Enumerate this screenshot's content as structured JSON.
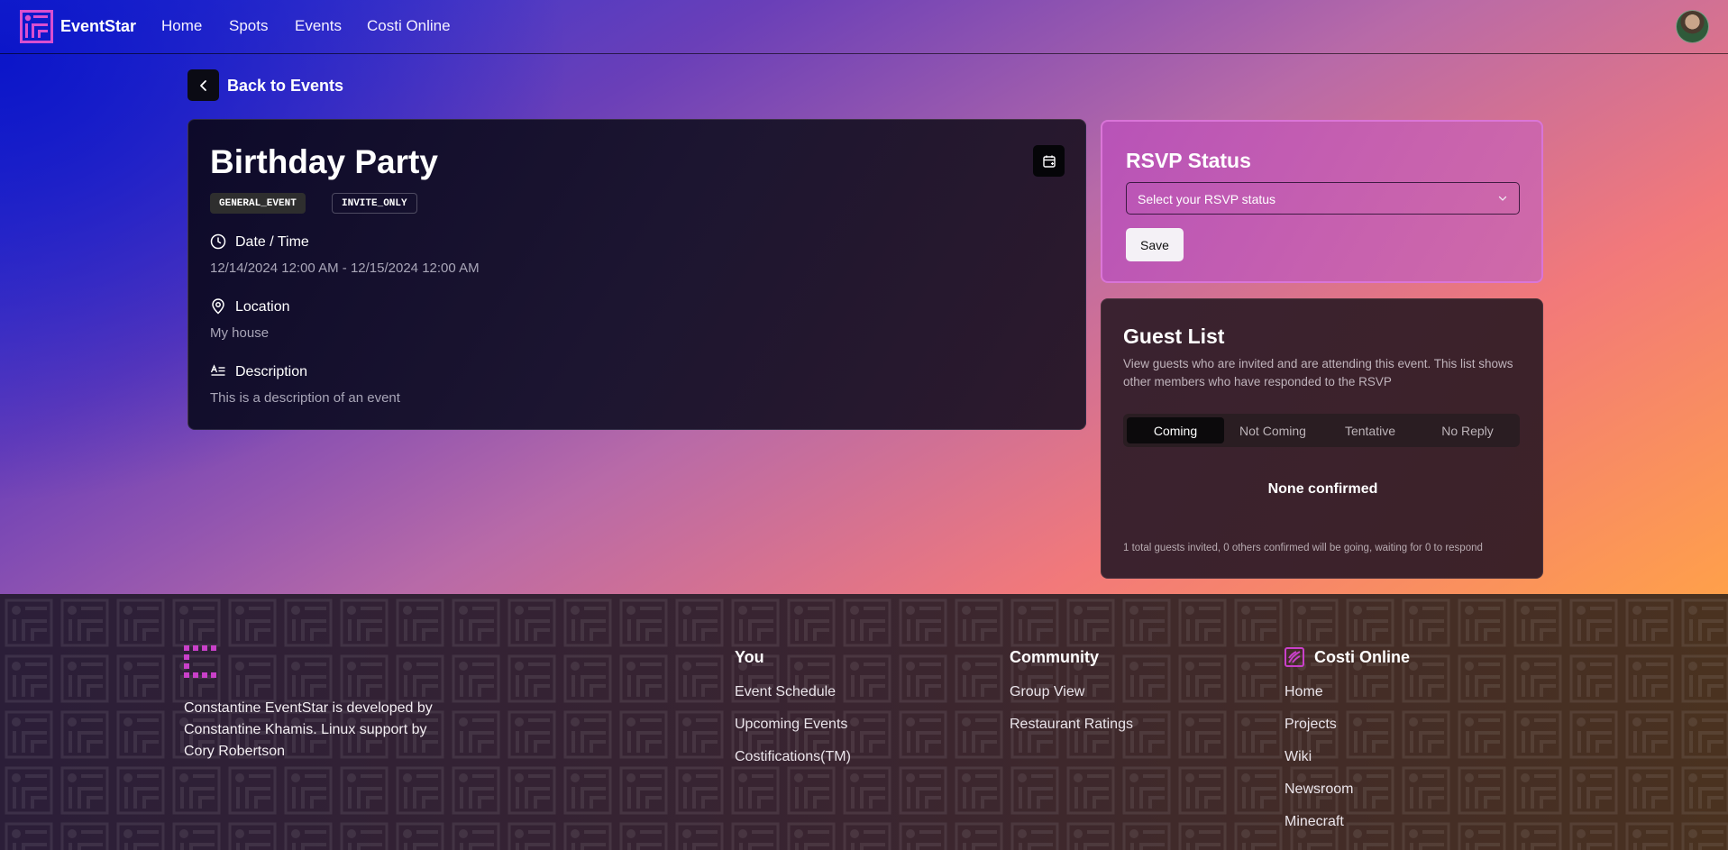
{
  "colors": {
    "accent": "#c940c9",
    "card_dark": "#140f28",
    "rsvp_card": "#c25aad",
    "guest_card": "#3b2229"
  },
  "nav": {
    "brand": "EventStar",
    "links": [
      "Home",
      "Spots",
      "Events",
      "Costi Online"
    ]
  },
  "back": {
    "label": "Back to Events",
    "icon": "chevron-left-icon"
  },
  "event": {
    "title": "Birthday Party",
    "tags": [
      "GENERAL_EVENT",
      "INVITE_ONLY"
    ],
    "fields": [
      {
        "icon": "clock-icon",
        "label": "Date / Time",
        "value": "12/14/2024 12:00 AM - 12/15/2024 12:00 AM"
      },
      {
        "icon": "map-pin-icon",
        "label": "Location",
        "value": "My house"
      },
      {
        "icon": "text-align-icon",
        "label": "Description",
        "value": "This is a description of an event"
      }
    ]
  },
  "rsvp": {
    "title": "RSVP Status",
    "placeholder": "Select your RSVP status",
    "save_label": "Save"
  },
  "guests": {
    "title": "Guest List",
    "description": "View guests who are invited and are attending this event. This list shows other members who have responded to the RSVP",
    "tabs": [
      "Coming",
      "Not Coming",
      "Tentative",
      "No Reply"
    ],
    "active_tab": "Coming",
    "empty_text": "None confirmed",
    "summary": "1 total guests invited, 0 others confirmed will be going, waiting for 0 to respond"
  },
  "footer": {
    "about": "Constantine EventStar is developed by Constantine Khamis. Linux support by Cory Robertson",
    "columns": [
      {
        "title": "You",
        "links": [
          "Event Schedule",
          "Upcoming Events",
          "Costifications(TM)"
        ]
      },
      {
        "title": "Community",
        "links": [
          "Group View",
          "Restaurant Ratings"
        ]
      },
      {
        "title": "Costi Online",
        "links": [
          "Home",
          "Projects",
          "Wiki",
          "Newsroom",
          "Minecraft"
        ]
      }
    ]
  }
}
